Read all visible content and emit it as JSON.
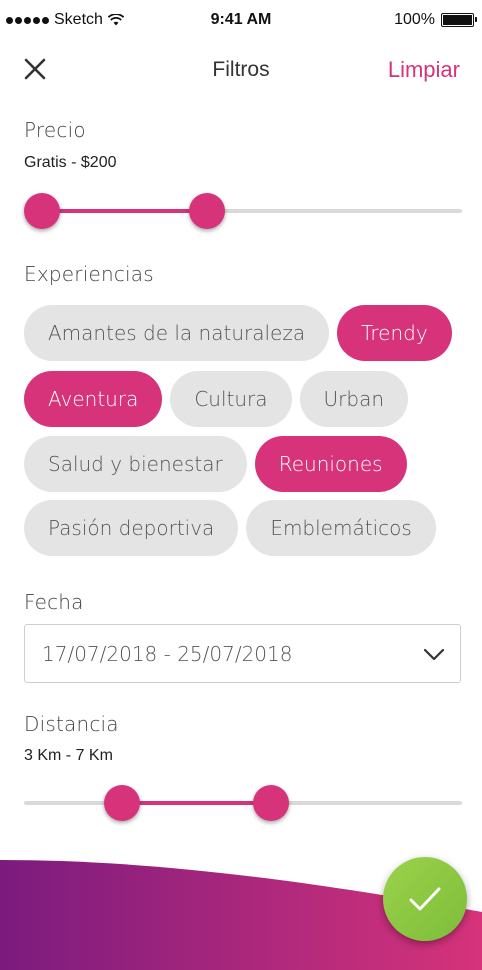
{
  "status_bar": {
    "carrier": "Sketch",
    "time": "9:41 AM",
    "battery": "100%"
  },
  "nav": {
    "title": "Filtros",
    "clear_label": "Limpiar",
    "close_icon": "close-icon"
  },
  "price": {
    "label": "Precio",
    "value": "Gratis - $200",
    "range_fraction": [
      0.0,
      0.41
    ]
  },
  "experiences": {
    "label": "Experiencias",
    "chips": [
      {
        "label": "Amantes de la naturaleza",
        "selected": false
      },
      {
        "label": "Trendy",
        "selected": true
      },
      {
        "label": "Aventura",
        "selected": true
      },
      {
        "label": "Cultura",
        "selected": false
      },
      {
        "label": "Urban",
        "selected": false
      },
      {
        "label": "Salud y bienestar",
        "selected": false
      },
      {
        "label": "Reuniones",
        "selected": true
      },
      {
        "label": "Pasión deportiva",
        "selected": false
      },
      {
        "label": "Emblemáticos",
        "selected": false
      }
    ]
  },
  "date": {
    "label": "Fecha",
    "value": "17/07/2018 - 25/07/2018",
    "icon": "chevron-down-icon"
  },
  "distance": {
    "label": "Distancia",
    "value": "3 Km - 7 Km",
    "range_fraction": [
      0.2,
      0.57
    ]
  },
  "apply_button": {
    "icon": "check-icon"
  },
  "colors": {
    "accent": "#d6337a",
    "chip_bg": "#e4e4e4",
    "track": "#d9d9d9",
    "fab": "#8cc63f",
    "wave_start": "#7b1b7e",
    "wave_end": "#d6337a"
  }
}
